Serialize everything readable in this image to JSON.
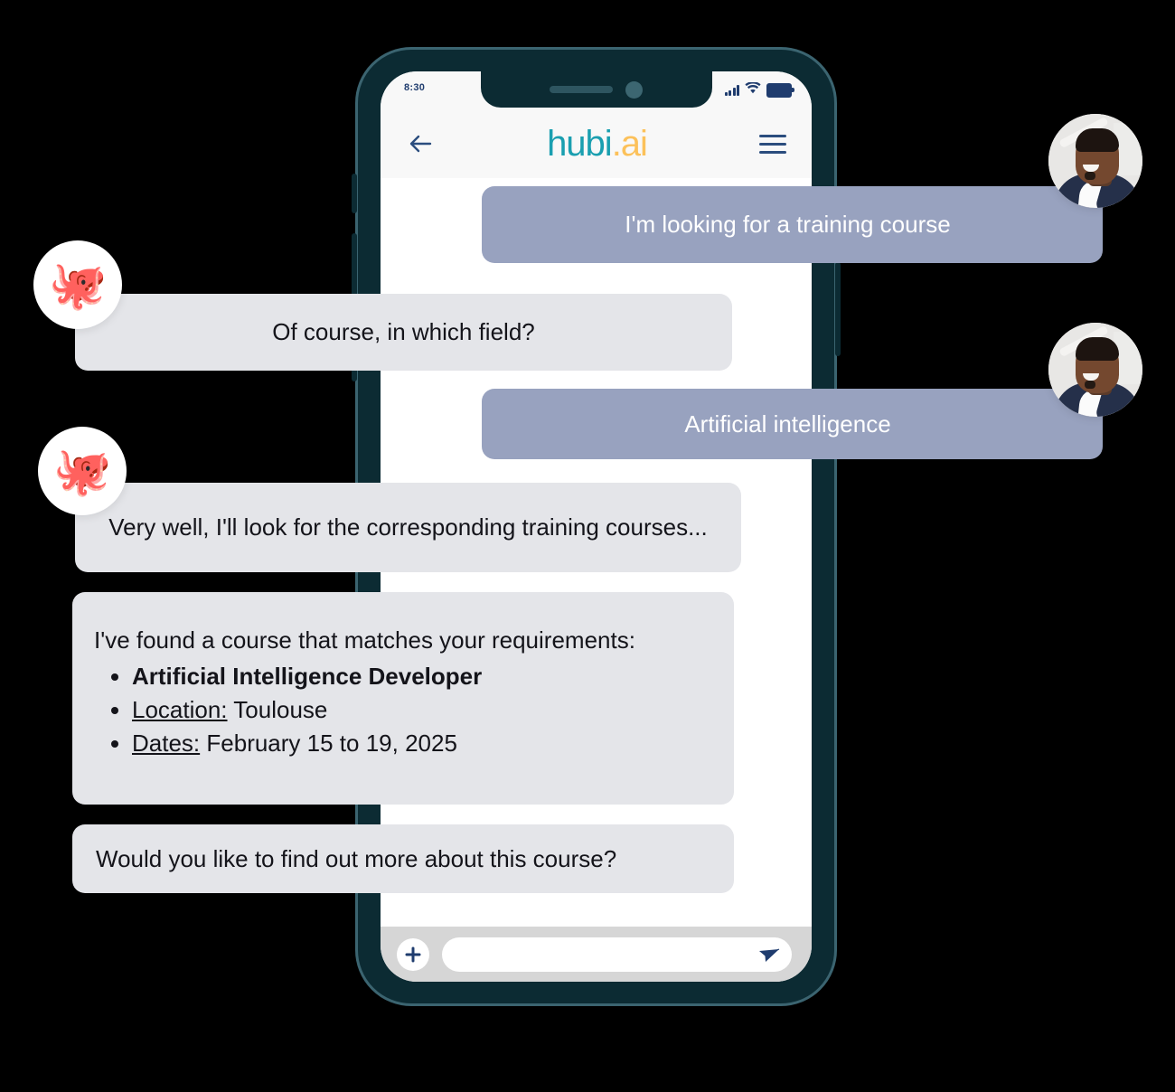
{
  "app": {
    "brand_main": "hubi",
    "brand_tld": ".ai",
    "accent_teal": "#1a9fb0",
    "accent_amber": "#fcc15a",
    "frame_color": "#0c2b33",
    "user_bubble_color": "#98a2bf",
    "bot_bubble_color": "#e4e5e9"
  },
  "status_bar": {
    "time": "8:30",
    "signal_icon": "signal-bars-icon",
    "wifi_icon": "wifi-icon",
    "battery_icon": "battery-icon"
  },
  "header": {
    "back_icon": "back-arrow-icon",
    "menu_icon": "hamburger-menu-icon"
  },
  "messages": [
    {
      "id": "m1",
      "sender": "user",
      "text": "I'm looking for a training course",
      "avatar": "user-photo-avatar"
    },
    {
      "id": "m2",
      "sender": "bot",
      "text": "Of course, in which field?",
      "avatar": "octopus-avatar",
      "avatar_glyph": "🐙"
    },
    {
      "id": "m3",
      "sender": "user",
      "text": "Artificial intelligence",
      "avatar": "user-photo-avatar"
    },
    {
      "id": "m4",
      "sender": "bot",
      "text": "Very well, I'll look for the corresponding training courses...",
      "avatar": "octopus-avatar",
      "avatar_glyph": "🐙"
    },
    {
      "id": "m5",
      "sender": "bot",
      "intro": "I've found a course that matches your requirements:",
      "bullets": [
        {
          "label": "",
          "value": "Artificial Intelligence Developer",
          "style": "bold"
        },
        {
          "label": "Location:",
          "value": "Toulouse",
          "style": "underline-label"
        },
        {
          "label": "Dates:",
          "value": "February 15 to 19, 2025",
          "style": "underline-label"
        }
      ]
    },
    {
      "id": "m6",
      "sender": "bot",
      "text": "Would you like to find out more about this course?"
    }
  ],
  "input_bar": {
    "add_icon": "plus-icon",
    "value": "",
    "placeholder": "",
    "send_icon": "send-icon"
  }
}
